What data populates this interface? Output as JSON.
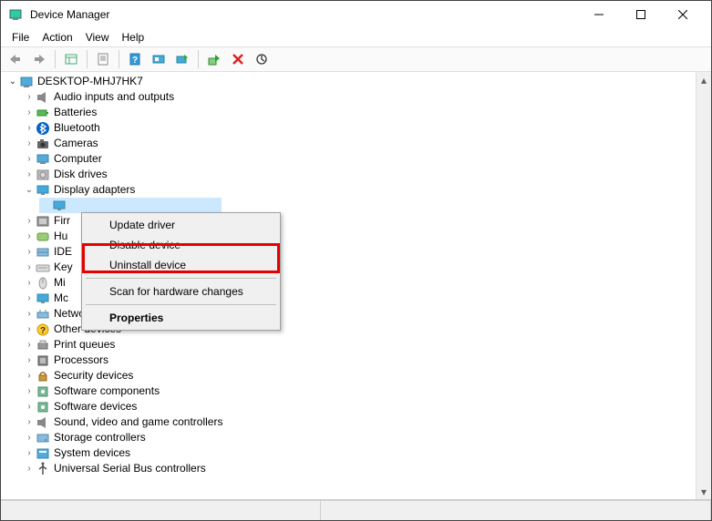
{
  "window": {
    "title": "Device Manager"
  },
  "menubar": [
    "File",
    "Action",
    "View",
    "Help"
  ],
  "tree": {
    "root": "DESKTOP-MHJ7HK7",
    "items": [
      {
        "label": "Audio inputs and outputs",
        "icon": "speaker"
      },
      {
        "label": "Batteries",
        "icon": "battery"
      },
      {
        "label": "Bluetooth",
        "icon": "bluetooth"
      },
      {
        "label": "Cameras",
        "icon": "camera"
      },
      {
        "label": "Computer",
        "icon": "computer"
      },
      {
        "label": "Disk drives",
        "icon": "disk"
      },
      {
        "label": "Display adapters",
        "icon": "display",
        "expanded": true,
        "children": [
          ""
        ]
      },
      {
        "label": "Firr",
        "icon": "firmware"
      },
      {
        "label": "Hu",
        "icon": "hid"
      },
      {
        "label": "IDE",
        "icon": "ide"
      },
      {
        "label": "Key",
        "icon": "keyboard"
      },
      {
        "label": "Mi",
        "icon": "mouse"
      },
      {
        "label": "Mc",
        "icon": "monitor"
      },
      {
        "label": "Network adapters",
        "icon": "network"
      },
      {
        "label": "Other devices",
        "icon": "question"
      },
      {
        "label": "Print queues",
        "icon": "printer"
      },
      {
        "label": "Processors",
        "icon": "cpu"
      },
      {
        "label": "Security devices",
        "icon": "security"
      },
      {
        "label": "Software components",
        "icon": "sw"
      },
      {
        "label": "Software devices",
        "icon": "sw"
      },
      {
        "label": "Sound, video and game controllers",
        "icon": "speaker"
      },
      {
        "label": "Storage controllers",
        "icon": "storage"
      },
      {
        "label": "System devices",
        "icon": "system"
      },
      {
        "label": "Universal Serial Bus controllers",
        "icon": "usb"
      }
    ]
  },
  "context_menu": {
    "items": [
      {
        "label": "Update driver"
      },
      {
        "label": "Disable device"
      },
      {
        "label": "Uninstall device"
      },
      {
        "sep": true
      },
      {
        "label": "Scan for hardware changes"
      },
      {
        "sep": true
      },
      {
        "label": "Properties",
        "bold": true
      }
    ]
  }
}
